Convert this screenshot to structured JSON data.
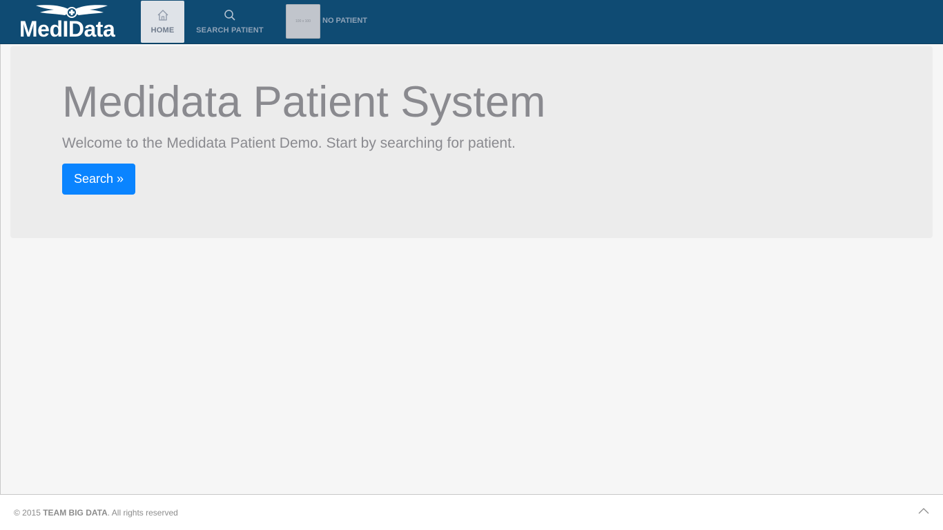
{
  "header": {
    "logo_text": "MedIData",
    "nav": {
      "home_label": "HOME",
      "search_label": "SEARCH PATIENT"
    },
    "patient": {
      "thumb_text": "100 x 100",
      "label": "NO PATIENT"
    }
  },
  "main": {
    "title": "Medidata Patient System",
    "lead": "Welcome to the Medidata Patient Demo. Start by searching for patient.",
    "search_button": "Search »"
  },
  "footer": {
    "copyright_prefix": "© 2015",
    "team": "TEAM BIG DATA",
    "suffix": ". All rights reserved"
  },
  "colors": {
    "topbar": "#0f4b73",
    "accent_button": "#0a84ff",
    "jumbotron": "#ececec",
    "page_bg": "#f6f6f6"
  },
  "icons": {
    "logo": "winged-cross-logo-icon",
    "home": "home-icon",
    "search": "search-icon",
    "scroll_top": "chevron-up-icon"
  }
}
